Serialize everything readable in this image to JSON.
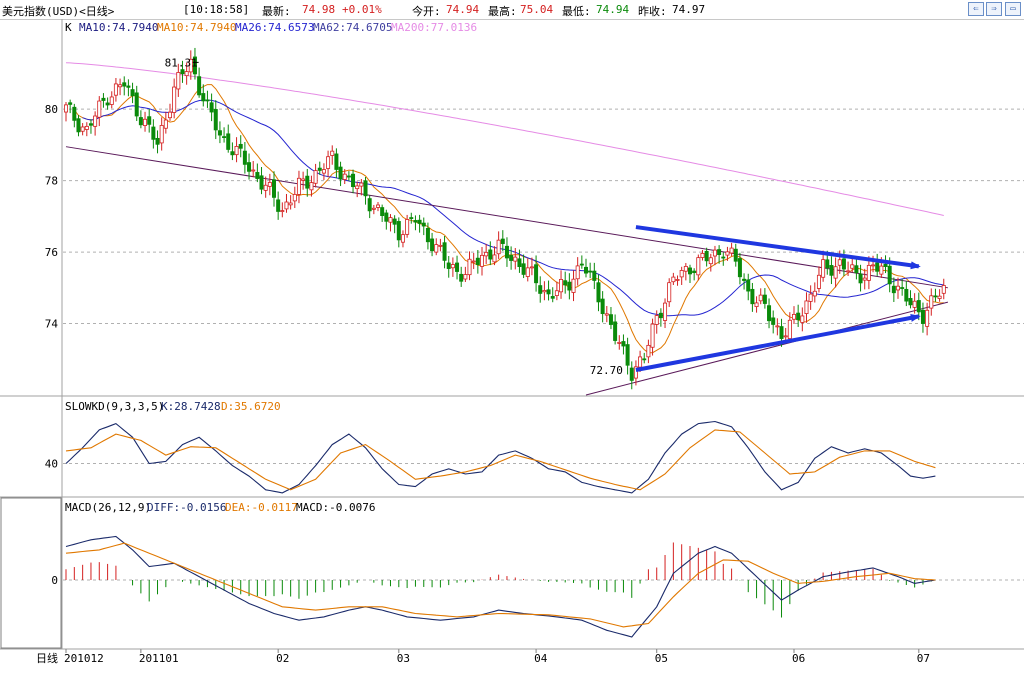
{
  "header": {
    "title": "美元指数(USD)<日线>",
    "time": "[10:18:58]",
    "latest_label": "最新:",
    "latest_value": "74.98",
    "change": "+0.01%",
    "open_label": "今开:",
    "open_value": "74.94",
    "high_label": "最高:",
    "high_value": "75.04",
    "low_label": "最低:",
    "low_value": "74.94",
    "prev_label": "昨收:",
    "prev_value": "74.97"
  },
  "colors": {
    "up": "#d42020",
    "down": "#0a8a0a",
    "ma10a": "#1a1a80",
    "ma10b": "#e07800",
    "ma26": "#2424d0",
    "ma62": "#4040a0",
    "ma200": "#e58be5",
    "trendline": "#5a1a5a",
    "arrow": "#1f37e0",
    "kline": "#1a2a6a",
    "dline": "#e07800"
  },
  "chart_data": [
    {
      "type": "candlestick",
      "title": "K",
      "legend": [
        {
          "name": "MA10",
          "value": "74.7940",
          "color": "#1a1a80"
        },
        {
          "name": "MA10",
          "value": "74.7940",
          "color": "#e07800"
        },
        {
          "name": "MA26",
          "value": "74.6573",
          "color": "#2424d0"
        },
        {
          "name": "MA62",
          "value": "74.6705",
          "color": "#4040a0"
        },
        {
          "name": "MA200",
          "value": "77.0136",
          "color": "#e58be5"
        }
      ],
      "yticks": [
        74,
        76,
        78,
        80
      ],
      "ylim": [
        72.0,
        82.3
      ],
      "annotations": [
        {
          "label": "81.31",
          "value": 81.31
        },
        {
          "label": "72.70",
          "value": 72.7
        }
      ],
      "x_axis_label": "日线",
      "x_ticks": [
        "201012",
        "201101",
        "02",
        "03",
        "04",
        "05",
        "06",
        "07"
      ],
      "key_points": [
        [
          0,
          80.0
        ],
        [
          5,
          79.4
        ],
        [
          10,
          80.4
        ],
        [
          14,
          80.7
        ],
        [
          18,
          79.8
        ],
        [
          22,
          79.0
        ],
        [
          26,
          80.6
        ],
        [
          30,
          81.31
        ],
        [
          34,
          80.0
        ],
        [
          37,
          79.3
        ],
        [
          40,
          78.9
        ],
        [
          44,
          78.4
        ],
        [
          48,
          77.8
        ],
        [
          52,
          77.2
        ],
        [
          56,
          77.8
        ],
        [
          60,
          78.2
        ],
        [
          64,
          78.6
        ],
        [
          68,
          78.0
        ],
        [
          72,
          77.6
        ],
        [
          76,
          77.0
        ],
        [
          80,
          76.6
        ],
        [
          84,
          76.9
        ],
        [
          88,
          76.3
        ],
        [
          92,
          75.6
        ],
        [
          96,
          75.4
        ],
        [
          100,
          75.9
        ],
        [
          104,
          76.1
        ],
        [
          108,
          75.8
        ],
        [
          112,
          75.3
        ],
        [
          116,
          74.8
        ],
        [
          120,
          75.0
        ],
        [
          124,
          75.7
        ],
        [
          128,
          74.8
        ],
        [
          132,
          73.6
        ],
        [
          136,
          72.7
        ],
        [
          139,
          73.0
        ],
        [
          142,
          74.2
        ],
        [
          146,
          75.2
        ],
        [
          150,
          75.6
        ],
        [
          154,
          75.8
        ],
        [
          158,
          76.1
        ],
        [
          161,
          75.7
        ],
        [
          164,
          74.9
        ],
        [
          168,
          74.4
        ],
        [
          172,
          73.7
        ],
        [
          175,
          74.0
        ],
        [
          178,
          74.6
        ],
        [
          182,
          75.5
        ],
        [
          186,
          75.7
        ],
        [
          190,
          75.3
        ],
        [
          194,
          75.6
        ],
        [
          197,
          75.4
        ],
        [
          200,
          75.0
        ],
        [
          203,
          74.5
        ],
        [
          206,
          74.3
        ],
        [
          209,
          74.7
        ],
        [
          211,
          74.95
        ]
      ],
      "candles": 212,
      "trendlines": [
        {
          "from": [
            0,
            78.95
          ],
          "to": [
            212,
            75.0
          ]
        },
        {
          "from": [
            125,
            72.0
          ],
          "to": [
            212,
            74.6
          ]
        }
      ],
      "arrows": [
        {
          "from": [
            137,
            76.7
          ],
          "to": [
            205,
            75.6
          ]
        },
        {
          "from": [
            137,
            72.7
          ],
          "to": [
            205,
            74.2
          ]
        }
      ]
    },
    {
      "type": "line",
      "title": "SLOWKD(9,3,3,5)",
      "series": [
        {
          "name": "K",
          "value": "28.7428",
          "color": "#1a2a6a"
        },
        {
          "name": "D",
          "value": "35.6720",
          "color": "#e07800"
        }
      ],
      "yticks": [
        40
      ],
      "ylim": [
        10,
        90
      ],
      "k_points": [
        [
          0,
          40
        ],
        [
          4,
          55
        ],
        [
          8,
          72
        ],
        [
          12,
          78
        ],
        [
          16,
          65
        ],
        [
          20,
          40
        ],
        [
          24,
          42
        ],
        [
          28,
          58
        ],
        [
          32,
          65
        ],
        [
          36,
          52
        ],
        [
          40,
          38
        ],
        [
          44,
          28
        ],
        [
          48,
          15
        ],
        [
          52,
          12
        ],
        [
          56,
          20
        ],
        [
          60,
          38
        ],
        [
          64,
          58
        ],
        [
          68,
          68
        ],
        [
          72,
          55
        ],
        [
          76,
          35
        ],
        [
          80,
          20
        ],
        [
          84,
          18
        ],
        [
          88,
          30
        ],
        [
          92,
          35
        ],
        [
          96,
          30
        ],
        [
          100,
          32
        ],
        [
          104,
          48
        ],
        [
          108,
          52
        ],
        [
          112,
          45
        ],
        [
          116,
          35
        ],
        [
          120,
          32
        ],
        [
          124,
          22
        ],
        [
          128,
          18
        ],
        [
          132,
          15
        ],
        [
          136,
          12
        ],
        [
          140,
          25
        ],
        [
          144,
          50
        ],
        [
          148,
          68
        ],
        [
          152,
          78
        ],
        [
          156,
          80
        ],
        [
          160,
          75
        ],
        [
          164,
          55
        ],
        [
          168,
          32
        ],
        [
          172,
          15
        ],
        [
          176,
          22
        ],
        [
          180,
          45
        ],
        [
          184,
          56
        ],
        [
          188,
          50
        ],
        [
          192,
          54
        ],
        [
          196,
          50
        ],
        [
          200,
          38
        ],
        [
          203,
          28
        ],
        [
          206,
          26
        ],
        [
          209,
          28
        ]
      ],
      "d_points": [
        [
          0,
          52
        ],
        [
          6,
          55
        ],
        [
          12,
          68
        ],
        [
          18,
          62
        ],
        [
          24,
          48
        ],
        [
          30,
          56
        ],
        [
          36,
          55
        ],
        [
          42,
          40
        ],
        [
          48,
          25
        ],
        [
          54,
          15
        ],
        [
          60,
          25
        ],
        [
          66,
          50
        ],
        [
          72,
          58
        ],
        [
          78,
          42
        ],
        [
          84,
          25
        ],
        [
          90,
          28
        ],
        [
          96,
          32
        ],
        [
          102,
          38
        ],
        [
          108,
          48
        ],
        [
          114,
          42
        ],
        [
          120,
          34
        ],
        [
          126,
          26
        ],
        [
          132,
          20
        ],
        [
          138,
          15
        ],
        [
          144,
          30
        ],
        [
          150,
          55
        ],
        [
          156,
          72
        ],
        [
          162,
          70
        ],
        [
          168,
          50
        ],
        [
          174,
          30
        ],
        [
          180,
          32
        ],
        [
          186,
          46
        ],
        [
          192,
          52
        ],
        [
          198,
          52
        ],
        [
          204,
          42
        ],
        [
          209,
          36
        ]
      ]
    },
    {
      "type": "bar",
      "title": "MACD(26,12,9)",
      "series": [
        {
          "name": "DIFF",
          "value": "-0.0156",
          "color": "#1a2a6a"
        },
        {
          "name": "DEA",
          "value": "-0.0117",
          "color": "#e07800"
        },
        {
          "name": "MACD",
          "value": "-0.0076",
          "color": "#000000"
        }
      ],
      "yticks": [
        0
      ],
      "ylim": [
        -1.0,
        1.0
      ],
      "diff_points": [
        [
          0,
          0.5
        ],
        [
          6,
          0.6
        ],
        [
          12,
          0.65
        ],
        [
          16,
          0.45
        ],
        [
          20,
          0.2
        ],
        [
          26,
          0.25
        ],
        [
          32,
          0.05
        ],
        [
          38,
          -0.15
        ],
        [
          44,
          -0.35
        ],
        [
          50,
          -0.5
        ],
        [
          56,
          -0.6
        ],
        [
          62,
          -0.55
        ],
        [
          68,
          -0.45
        ],
        [
          72,
          -0.4
        ],
        [
          76,
          -0.45
        ],
        [
          82,
          -0.55
        ],
        [
          90,
          -0.6
        ],
        [
          98,
          -0.55
        ],
        [
          104,
          -0.45
        ],
        [
          110,
          -0.5
        ],
        [
          118,
          -0.55
        ],
        [
          124,
          -0.6
        ],
        [
          130,
          -0.75
        ],
        [
          136,
          -0.85
        ],
        [
          142,
          -0.4
        ],
        [
          146,
          0.1
        ],
        [
          152,
          0.4
        ],
        [
          156,
          0.5
        ],
        [
          160,
          0.4
        ],
        [
          166,
          0.05
        ],
        [
          172,
          -0.3
        ],
        [
          176,
          -0.15
        ],
        [
          182,
          0.05
        ],
        [
          188,
          0.12
        ],
        [
          194,
          0.18
        ],
        [
          200,
          0.05
        ],
        [
          204,
          -0.05
        ],
        [
          209,
          0.0
        ]
      ],
      "dea_points": [
        [
          0,
          0.4
        ],
        [
          8,
          0.45
        ],
        [
          14,
          0.55
        ],
        [
          20,
          0.4
        ],
        [
          28,
          0.2
        ],
        [
          36,
          0.0
        ],
        [
          44,
          -0.2
        ],
        [
          52,
          -0.4
        ],
        [
          60,
          -0.45
        ],
        [
          68,
          -0.4
        ],
        [
          76,
          -0.4
        ],
        [
          84,
          -0.5
        ],
        [
          94,
          -0.55
        ],
        [
          104,
          -0.5
        ],
        [
          116,
          -0.52
        ],
        [
          126,
          -0.58
        ],
        [
          134,
          -0.7
        ],
        [
          140,
          -0.65
        ],
        [
          146,
          -0.25
        ],
        [
          152,
          0.1
        ],
        [
          158,
          0.3
        ],
        [
          164,
          0.28
        ],
        [
          170,
          0.1
        ],
        [
          176,
          -0.05
        ],
        [
          182,
          -0.02
        ],
        [
          190,
          0.05
        ],
        [
          198,
          0.1
        ],
        [
          204,
          0.02
        ],
        [
          209,
          0.0
        ]
      ]
    }
  ]
}
